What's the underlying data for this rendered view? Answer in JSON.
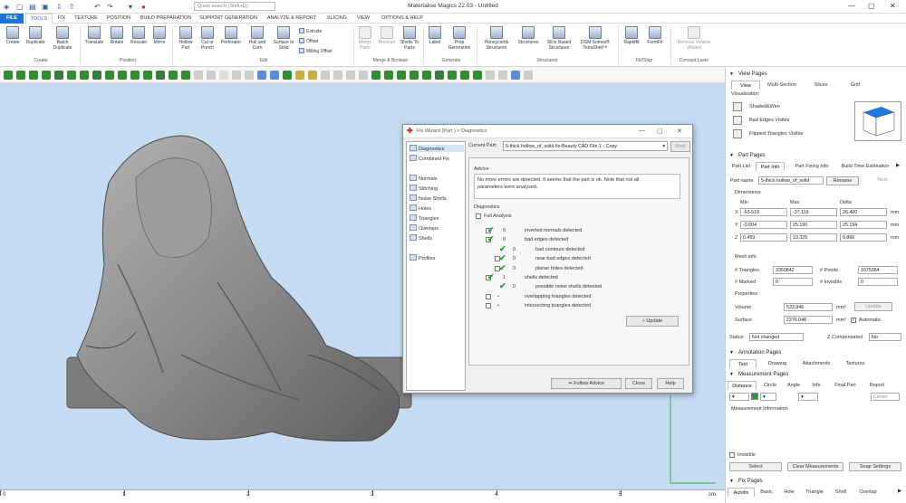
{
  "window": {
    "title": "Materialise Magics 22.03 - Untitled",
    "search_placeholder": "Quick search (Shift+Q)"
  },
  "menu": [
    "FILE",
    "TOOLS",
    "FIX",
    "TEXTURE",
    "POSITION",
    "BUILD PREPARATION",
    "SUPPORT GENERATION",
    "ANALYZE & REPORT",
    "SLICING",
    "VIEW",
    "OPTIONS & HELP"
  ],
  "ribbon": {
    "buttons": [
      {
        "name": "create",
        "label": "Create"
      },
      {
        "name": "duplicate",
        "label": "Duplicate"
      },
      {
        "name": "batch-duplicate",
        "label": "Batch Duplicate"
      },
      {
        "name": "translate",
        "label": "Translate"
      },
      {
        "name": "rotate",
        "label": "Rotate"
      },
      {
        "name": "rescale",
        "label": "Rescale"
      },
      {
        "name": "mirror",
        "label": "Mirror"
      },
      {
        "name": "hollow-part",
        "label": "Hollow Part"
      },
      {
        "name": "cut-or-punch",
        "label": "Cut or Punch"
      },
      {
        "name": "perforator",
        "label": "Perforator"
      },
      {
        "name": "hull-and-core",
        "label": "Hull and Core"
      },
      {
        "name": "surface-to-solid",
        "label": "Surface to Solid"
      },
      {
        "name": "merge-parts",
        "label": "Merge Parts"
      },
      {
        "name": "boolean",
        "label": "Boolean"
      },
      {
        "name": "shells-to-parts",
        "label": "Shells To Parts"
      },
      {
        "name": "label",
        "label": "Label"
      },
      {
        "name": "prop-generation",
        "label": "Prop Generation"
      },
      {
        "name": "honeycomb-structures",
        "label": "Honeycomb Structures"
      },
      {
        "name": "structures",
        "label": "Structures"
      },
      {
        "name": "slice-based-structures",
        "label": "Slice Based Structures"
      },
      {
        "name": "dsm-somos-tetrashell",
        "label": "DSM Somos® TetraShell™"
      },
      {
        "name": "rapidfit",
        "label": "Rapidfit"
      },
      {
        "name": "formfit",
        "label": "FormFit"
      },
      {
        "name": "remove-volume-wizard",
        "label": "Remove Volume Wizard"
      }
    ],
    "small": [
      "Extrude",
      "Offset",
      "Milling Offset"
    ],
    "groups": [
      "Create",
      "Position",
      "Edit",
      "Merge & Boolean",
      "Generate",
      "Structures",
      "Fit2Ship",
      "Concept Laser"
    ]
  },
  "dialog": {
    "title": "Fix Wizard (Part ) > Diagnostics",
    "nav": [
      "Diagnostics",
      "Combined Fix",
      "Normals",
      "Stitching",
      "Noise Shells",
      "Holes",
      "Triangles",
      "Overlaps",
      "Shells",
      "Profiles"
    ],
    "current_part_label": "Current Part:",
    "current_part": "5-thick hollow_of_solid-fix-Beauty CAD File-1 - Copy",
    "next": "Next",
    "advice_title": "Advice",
    "advice_text_1": "No more errors are detected. It seems that the part is ok. Note that not all",
    "advice_text_2": "parameters were analysed.",
    "diagnostics_title": "Diagnostics",
    "full_analysis": "Full Analysis",
    "rows": [
      {
        "count": "0",
        "label": "inverted normals detected"
      },
      {
        "count": "0",
        "label": "bad edges detected"
      },
      {
        "count": "0",
        "label": "bad contours detected"
      },
      {
        "count": "0",
        "label": "near bad edges detected"
      },
      {
        "count": "0",
        "label": "planar holes detected"
      },
      {
        "count": "1",
        "label": "shells detected"
      },
      {
        "count": "0",
        "label": "possible noise shells detected"
      },
      {
        "count": "•",
        "label": "overlapping triangles detected"
      },
      {
        "count": "•",
        "label": "intersecting triangles detected"
      }
    ],
    "update": "Update",
    "follow_advice": "Follow Advice",
    "close": "Close",
    "help": "Help"
  },
  "view_pages": {
    "header": "View Pages",
    "tabs": [
      "View",
      "Multi-Section",
      "Slices",
      "Grid"
    ],
    "visualization": "Visualization",
    "options": [
      "Shaded&Wire",
      "Bad Edges Visible",
      "Flipped Triangles Visible"
    ]
  },
  "part_pages": {
    "header": "Part Pages",
    "tabs": [
      "Part List",
      "Part Info",
      "Part Fixing Info",
      "Build Time Estimation"
    ],
    "part_name_label": "Part name",
    "part_name": "5-thick hollow_of_solid",
    "rename": "Rename",
    "next": "Next",
    "dimensions": "Dimensions",
    "cols": [
      "Min",
      "Max",
      "Delta"
    ],
    "axes": [
      "X",
      "Y",
      "Z"
    ],
    "unit": "mm",
    "dims": [
      [
        "-63.519",
        "-37.119",
        "26.400"
      ],
      [
        "-0.004",
        "25.190",
        "25.194"
      ],
      [
        "0.459",
        "10.325",
        "9.866"
      ]
    ],
    "mesh_info": "Mesh info",
    "triangles_label": "# Triangles",
    "triangles": "3350842",
    "points_label": "# Points",
    "points": "1675364",
    "marked_label": "# Marked",
    "marked": "0",
    "invisible_label": "# Invisible",
    "invisible": "0",
    "properties": "Properties",
    "volume_label": "Volume",
    "volume": "533.946",
    "volume_unit": "mm³",
    "surface_label": "Surface",
    "surface": "2276.048",
    "surface_unit": "mm²",
    "update": "Update",
    "automatic": "Automatic",
    "status_label": "Status",
    "status": "Not changed",
    "zcomp_label": "Z Compensated",
    "zcomp": "No"
  },
  "annotation_pages": {
    "header": "Annotation Pages",
    "tabs": [
      "Text",
      "Drawing",
      "Attachments",
      "Textures"
    ]
  },
  "measurement_pages": {
    "header": "Measurement Pages",
    "tabs": [
      "Distance",
      "Circle",
      "Angle",
      "Info",
      "Final Part",
      "Report"
    ],
    "center": "Center",
    "info": "Measurement Information",
    "invisible": "Invisible",
    "buttons": [
      "Select",
      "Clear Measurements",
      "Snap Settings"
    ]
  },
  "fix_pages": {
    "header": "Fix Pages",
    "tabs": [
      "Autofix",
      "Basic",
      "Hole",
      "Triangle",
      "Shell",
      "Overlap"
    ]
  },
  "ruler": {
    "labels": [
      "0",
      "1",
      "2",
      "3",
      "4",
      "5"
    ],
    "unit": "cm"
  }
}
